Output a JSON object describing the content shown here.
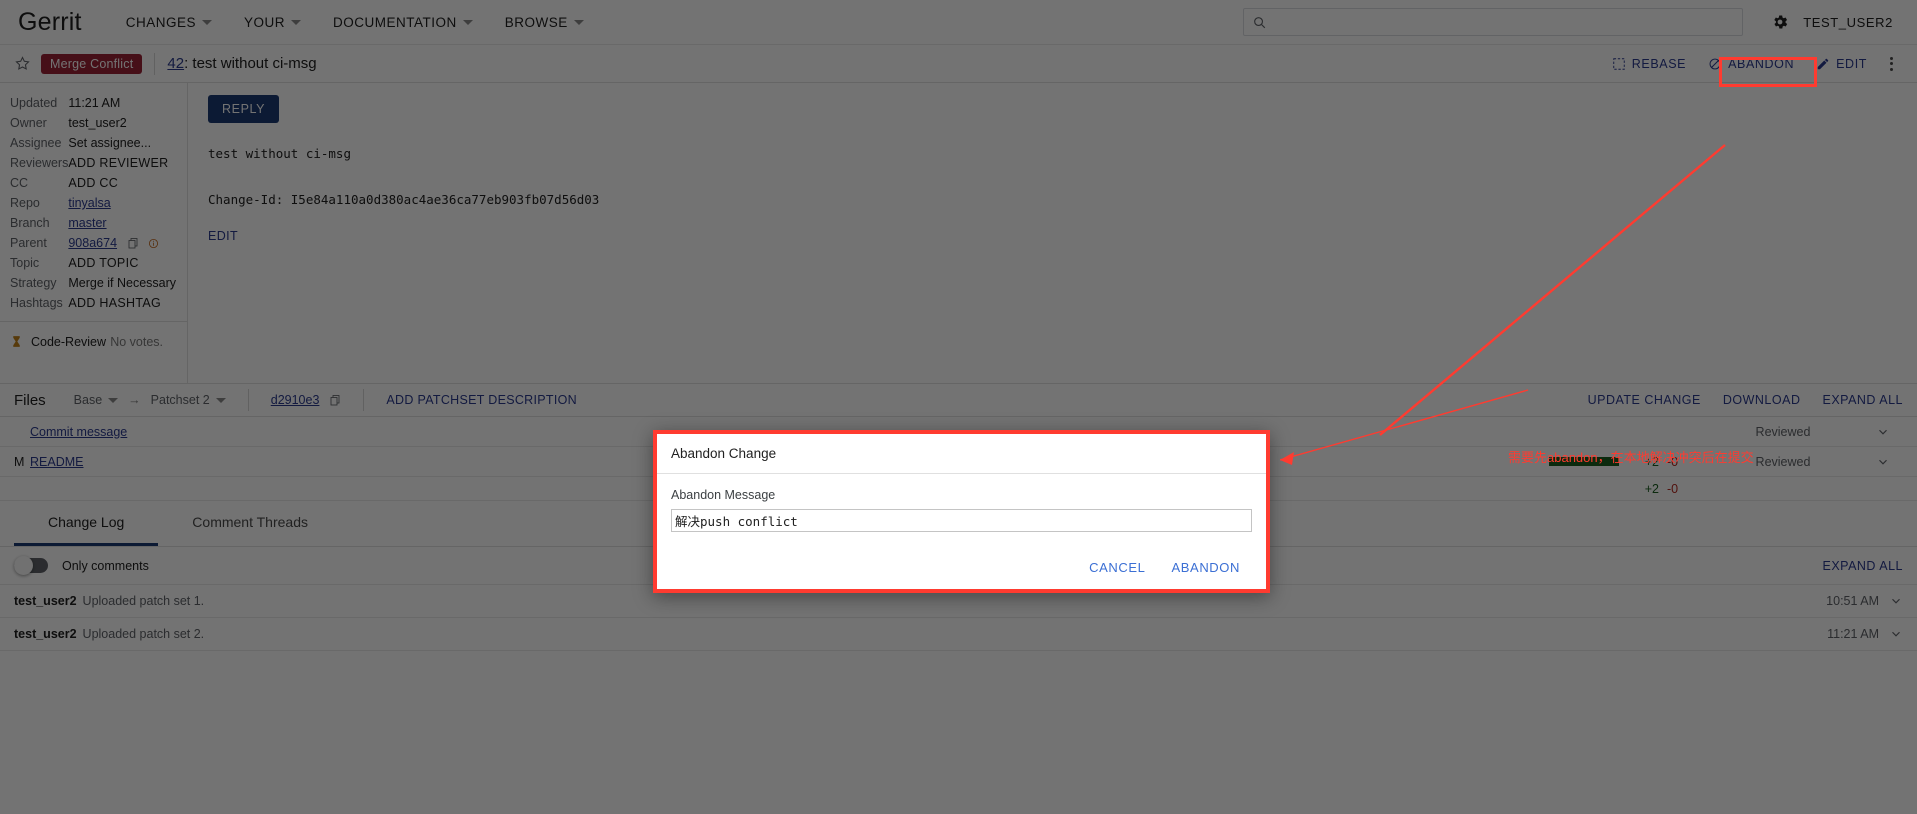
{
  "topnav": {
    "brand": "Gerrit",
    "items": [
      {
        "label": "CHANGES",
        "icon": "chevron-down-icon"
      },
      {
        "label": "YOUR",
        "icon": "chevron-down-icon"
      },
      {
        "label": "DOCUMENTATION",
        "icon": "chevron-down-icon"
      },
      {
        "label": "BROWSE",
        "icon": "chevron-down-icon"
      }
    ],
    "search": {
      "value": "",
      "placeholder": "",
      "icon": "search-icon"
    },
    "settings_icon": "gear-icon",
    "user": "TEST_USER2"
  },
  "change_header": {
    "star_icon": "star-outline-icon",
    "status": "Merge Conflict",
    "status_color": "#9c2237",
    "number": "42",
    "separator": ":",
    "subject": "test without ci-msg",
    "actions": [
      {
        "label": "REBASE",
        "icon": "rebase-icon"
      },
      {
        "label": "ABANDON",
        "icon": "abandon-icon"
      },
      {
        "label": "EDIT",
        "icon": "pencil-icon"
      }
    ],
    "more_icon": "kebab-menu-icon"
  },
  "metadata": {
    "rows": [
      {
        "key": "Updated",
        "value": "11:21 AM",
        "style": "plain"
      },
      {
        "key": "Owner",
        "value": "test_user2",
        "style": "plain"
      },
      {
        "key": "Assignee",
        "value": "Set assignee...",
        "style": "muted"
      },
      {
        "key": "Reviewers",
        "value": "ADD REVIEWER",
        "style": "action"
      },
      {
        "key": "CC",
        "value": "ADD CC",
        "style": "action"
      },
      {
        "key": "Repo",
        "value": "tinyalsa",
        "style": "link"
      },
      {
        "key": "Branch",
        "value": "master",
        "style": "link"
      },
      {
        "key": "Parent",
        "value": "908a674",
        "style": "link-extra"
      },
      {
        "key": "Topic",
        "value": "ADD TOPIC",
        "style": "action"
      },
      {
        "key": "Strategy",
        "value": "Merge if Necessary",
        "style": "plain"
      },
      {
        "key": "Hashtags",
        "value": "ADD HASHTAG",
        "style": "action"
      }
    ],
    "parent_copy_icon": "copy-icon",
    "parent_info_icon": "info-circle-icon",
    "vote": {
      "icon": "hourglass-icon",
      "label": "Code-Review",
      "value": "No votes."
    }
  },
  "commit": {
    "reply_label": "REPLY",
    "subject_line": "test without ci-msg",
    "change_id_line": "Change-Id: I5e84a110a0d380ac4ae36ca77eb903fb07d56d03",
    "edit_label": "EDIT"
  },
  "files": {
    "title": "Files",
    "base_label": "Base",
    "arrow": "→",
    "patchset_label": "Patchset 2",
    "revision": "d2910e3",
    "copy_icon": "copy-icon",
    "add_description_label": "ADD PATCHSET DESCRIPTION",
    "right_actions": [
      "UPDATE CHANGE",
      "DOWNLOAD",
      "EXPAND ALL"
    ],
    "rows": [
      {
        "status": "",
        "name": "Commit message",
        "added": "",
        "deleted": "",
        "reviewed": "Reviewed",
        "bar_added_pct": 0,
        "chevron": "chevron-down-icon"
      },
      {
        "status": "M",
        "name": "README",
        "added": "+2",
        "deleted": "-0",
        "reviewed": "Reviewed",
        "bar_added_pct": 100,
        "chevron": "chevron-down-icon"
      }
    ],
    "totals": {
      "added": "+2",
      "deleted": "-0"
    }
  },
  "log": {
    "tabs": [
      {
        "label": "Change Log",
        "active": true
      },
      {
        "label": "Comment Threads",
        "active": false
      }
    ],
    "toggle_label": "Only comments",
    "toggle_on": false,
    "expand_all_label": "EXPAND ALL",
    "entries": [
      {
        "user": "test_user2",
        "message": "Uploaded patch set 1.",
        "time": "10:51 AM",
        "chevron": "chevron-down-icon"
      },
      {
        "user": "test_user2",
        "message": "Uploaded patch set 2.",
        "time": "11:21 AM",
        "chevron": "chevron-down-icon"
      }
    ]
  },
  "modal": {
    "title": "Abandon Change",
    "message_label": "Abandon Message",
    "message_value": "解决push conflict",
    "message_placeholder": "",
    "cancel_label": "CANCEL",
    "confirm_label": "ABANDON"
  },
  "annotations": {
    "color": "#ff3b30",
    "note_text": "需要先abandon，在本地解决冲突后在提交"
  }
}
